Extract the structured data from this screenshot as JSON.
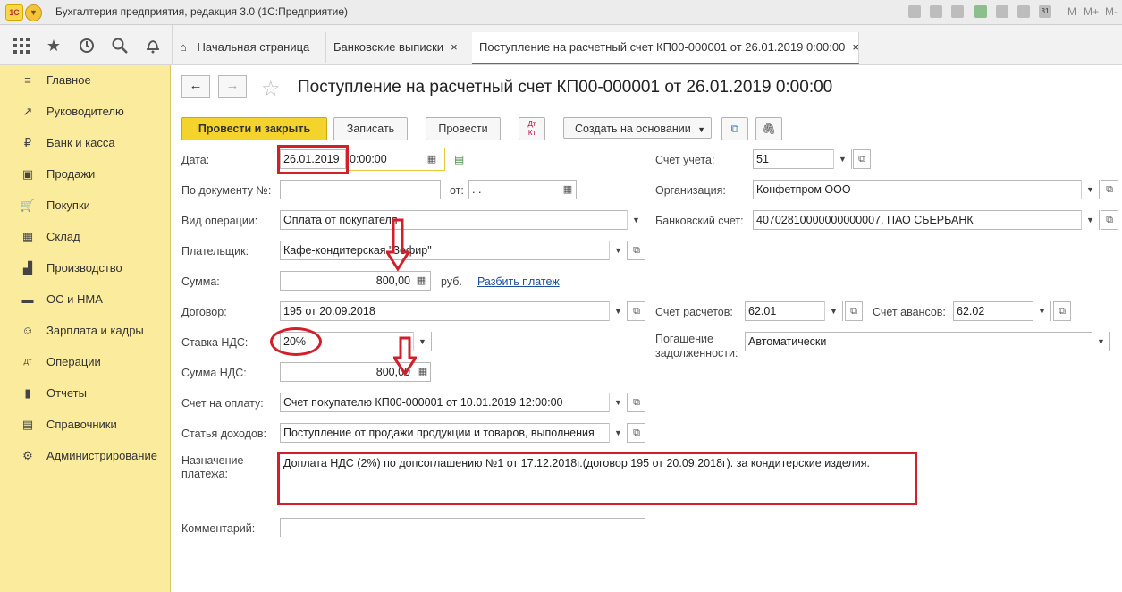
{
  "window": {
    "app_title": "Бухгалтерия предприятия, редакция 3.0  (1С:Предприятие)",
    "logo": "1С",
    "right_controls": [
      "M",
      "M+",
      "M-"
    ]
  },
  "nav_icons": [
    "apps-icon",
    "star-icon",
    "history-icon",
    "search-icon",
    "bell-icon"
  ],
  "tabs": {
    "home": "Начальная страница",
    "bank_statements": "Банковские выписки",
    "current": "Поступление на расчетный счет КП00-000001 от 26.01.2019 0:00:00",
    "close": "×"
  },
  "sidebar": {
    "items": [
      {
        "label": "Главное",
        "icon": "≡"
      },
      {
        "label": "Руководителю",
        "icon": "↗"
      },
      {
        "label": "Банк и касса",
        "icon": "₽"
      },
      {
        "label": "Продажи",
        "icon": "▣"
      },
      {
        "label": "Покупки",
        "icon": "🛒"
      },
      {
        "label": "Склад",
        "icon": "▦"
      },
      {
        "label": "Производство",
        "icon": "▟"
      },
      {
        "label": "ОС и НМА",
        "icon": "▬"
      },
      {
        "label": "Зарплата и кадры",
        "icon": "☺"
      },
      {
        "label": "Операции",
        "icon": "Дт"
      },
      {
        "label": "Отчеты",
        "icon": "▮"
      },
      {
        "label": "Справочники",
        "icon": "▤"
      },
      {
        "label": "Администрирование",
        "icon": "⚙"
      }
    ]
  },
  "document": {
    "title": "Поступление на расчетный счет КП00-000001 от 26.01.2019 0:00:00",
    "toolbar": {
      "post_close": "Провести и закрыть",
      "save": "Записать",
      "post": "Провести",
      "dtkt": "Дт\nКт",
      "create_based": "Создать на основании"
    },
    "fields": {
      "date_label": "Дата:",
      "date_value": "26.01.2019",
      "time_value": "0:00:00",
      "doc_num_label": "По документу №:",
      "doc_num_value": "",
      "from_label": "от:",
      "from_value": " .  .",
      "operation_label": "Вид операции:",
      "operation_value": "Оплата от покупателя",
      "payer_label": "Плательщик:",
      "payer_value": "Кафе-кондитерская \"Зефир\"",
      "sum_label": "Сумма:",
      "sum_value": "800,00",
      "sum_currency": "руб.",
      "split_payment": "Разбить платеж",
      "contract_label": "Договор:",
      "contract_value": "195 от 20.09.2018",
      "vat_rate_label": "Ставка НДС:",
      "vat_rate_value": "20%",
      "vat_sum_label": "Сумма НДС:",
      "vat_sum_value": "800,00",
      "invoice_label": "Счет на оплату:",
      "invoice_value": "Счет покупателю КП00-000001 от 10.01.2019 12:00:00",
      "income_label": "Статья доходов:",
      "income_value": "Поступление от продажи продукции и товаров, выполнения",
      "purpose_label": "Назначение платежа:",
      "purpose_value": "Доплата НДС (2%) по допсоглашению №1 от 17.12.2018г.(договор 195 от 20.09.2018г). за кондитерские изделия.",
      "comment_label": "Комментарий:",
      "comment_value": "",
      "account_label": "Счет учета:",
      "account_value": "51",
      "org_label": "Организация:",
      "org_value": "Конфетпром ООО",
      "bank_label": "Банковский счет:",
      "bank_value": "40702810000000000007, ПАО СБЕРБАНК",
      "settle_label": "Счет расчетов:",
      "settle_value": "62.01",
      "advance_label": "Счет авансов:",
      "advance_value": "62.02",
      "repay_label": "Погашение задолженности:",
      "repay_value": "Автоматически"
    }
  },
  "annotation_color": "#d21f2b"
}
